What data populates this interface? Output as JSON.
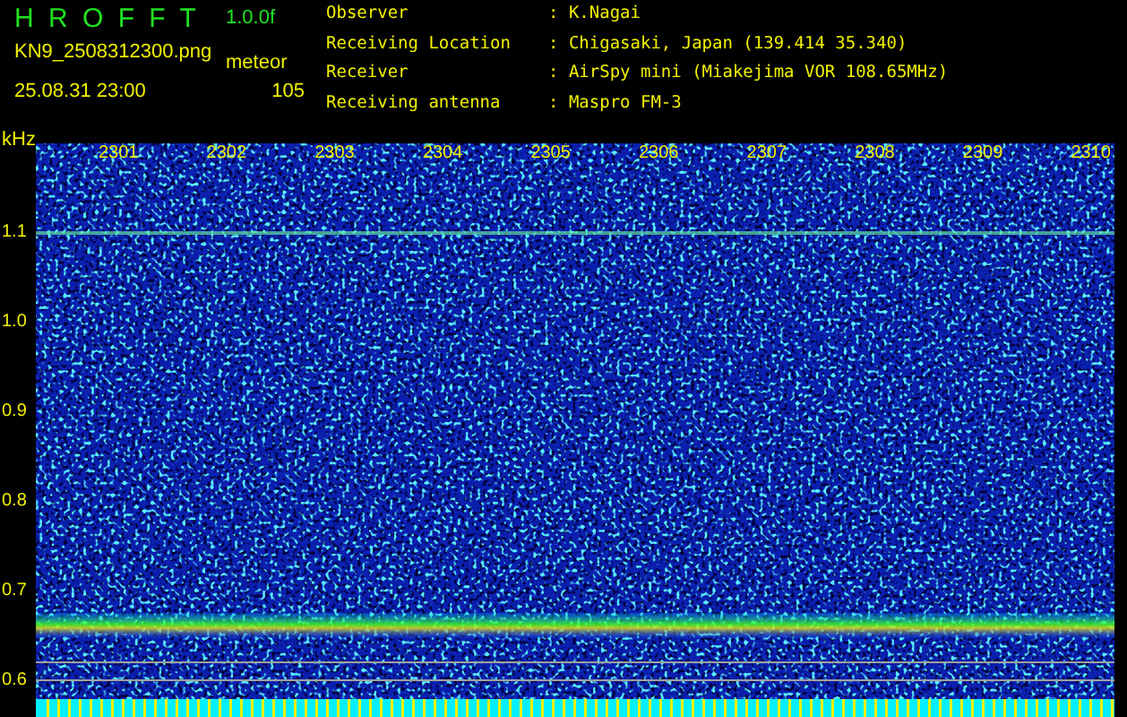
{
  "app": {
    "title": "H R O F F T",
    "version": "1.0.0f",
    "file": "KN9_2508312300.png",
    "mode": "meteor",
    "datetime": "25.08.31 23:00",
    "count": "105"
  },
  "info": [
    {
      "label": "Observer",
      "value": ": K.Nagai"
    },
    {
      "label": "Receiving Location",
      "value": ": Chigasaki, Japan (139.414 35.340)"
    },
    {
      "label": "Receiver",
      "value": ": AirSpy mini (Miakejima VOR 108.65MHz)"
    },
    {
      "label": "Receiving antenna",
      "value": ": Maspro FM-3"
    }
  ],
  "spectrogram": {
    "unit": "kHz",
    "x_labels": [
      "2301",
      "2302",
      "2303",
      "2304",
      "2305",
      "2306",
      "2307",
      "2308",
      "2309",
      "2310"
    ],
    "y_labels": [
      "1.1",
      "1.0",
      "0.9",
      "0.8",
      "0.7",
      "0.6"
    ]
  }
}
